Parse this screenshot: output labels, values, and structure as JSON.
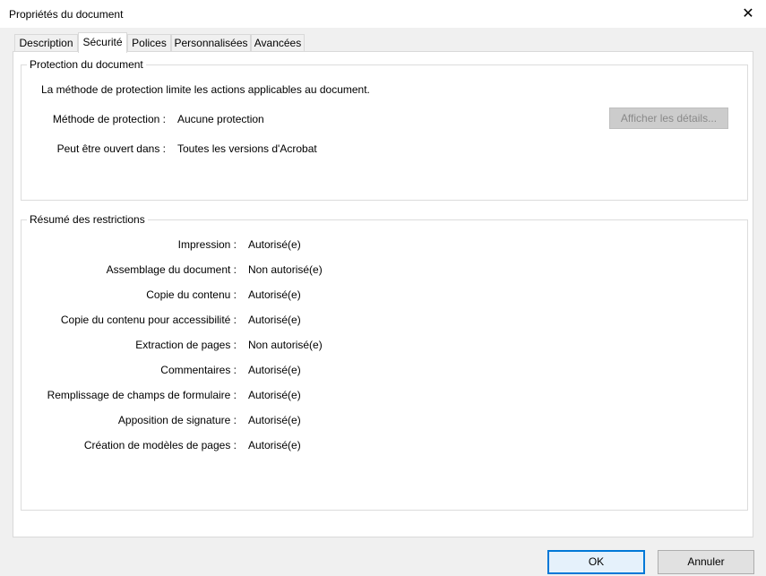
{
  "window": {
    "title": "Propriétés du document",
    "close_glyph": "✕"
  },
  "tabs": [
    {
      "label": "Description",
      "active": false
    },
    {
      "label": "Sécurité",
      "active": true
    },
    {
      "label": "Polices",
      "active": false
    },
    {
      "label": "Personnalisées",
      "active": false
    },
    {
      "label": "Avancées",
      "active": false
    }
  ],
  "protection": {
    "group_title": "Protection du document",
    "description": "La méthode de protection limite les actions applicables au document.",
    "method_label": "Méthode de protection :",
    "method_value": "Aucune protection",
    "open_label": "Peut être ouvert dans :",
    "open_value": "Toutes les versions d'Acrobat",
    "details_button": "Afficher les détails..."
  },
  "restrictions": {
    "group_title": "Résumé des restrictions",
    "items": [
      {
        "label": "Impression :",
        "value": "Autorisé(e)"
      },
      {
        "label": "Assemblage du document :",
        "value": "Non autorisé(e)"
      },
      {
        "label": "Copie du contenu :",
        "value": "Autorisé(e)"
      },
      {
        "label": "Copie du contenu pour accessibilité :",
        "value": "Autorisé(e)"
      },
      {
        "label": "Extraction de pages :",
        "value": "Non autorisé(e)"
      },
      {
        "label": "Commentaires :",
        "value": "Autorisé(e)"
      },
      {
        "label": "Remplissage de champs de formulaire :",
        "value": "Autorisé(e)"
      },
      {
        "label": "Apposition de signature :",
        "value": "Autorisé(e)"
      },
      {
        "label": "Création de modèles de pages :",
        "value": "Autorisé(e)"
      }
    ]
  },
  "footer": {
    "ok_label": "OK",
    "cancel_label": "Annuler"
  }
}
